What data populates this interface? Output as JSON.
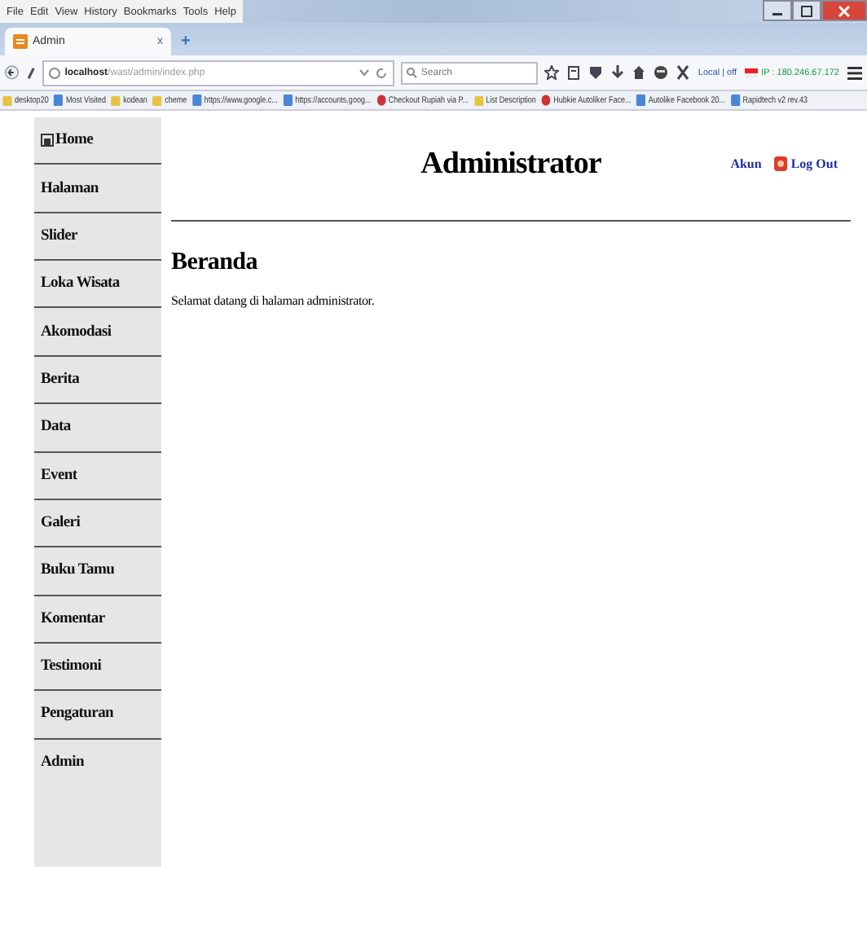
{
  "menu_bar": [
    "File",
    "Edit",
    "View",
    "History",
    "Bookmarks",
    "Tools",
    "Help"
  ],
  "tabs": [
    {
      "label": "Admin",
      "close": "x",
      "selected": true
    }
  ],
  "new_tab": "+",
  "address_bar": {
    "host": "localhost",
    "path": "/wast/admin/index.php"
  },
  "search": {
    "placeholder": "Search"
  },
  "ip_info": {
    "status": "Local | off",
    "ip": "IP : 180.246.67.172"
  },
  "bookmarks": [
    {
      "label": "desktop20",
      "kind": "folder"
    },
    {
      "label": "Most Visited",
      "kind": "page"
    },
    {
      "label": "kodean",
      "kind": "folder"
    },
    {
      "label": "cheme",
      "kind": "folder"
    },
    {
      "label": "https://www.google.c...",
      "kind": "page"
    },
    {
      "label": "https://accounts.goog...",
      "kind": "page"
    },
    {
      "label": "Checkout Rupiah via P...",
      "kind": "site"
    },
    {
      "label": "List Description",
      "kind": "folder"
    },
    {
      "label": "Hubkie Autoliker Face...",
      "kind": "site"
    },
    {
      "label": "Autolike Facebook 20...",
      "kind": "page"
    },
    {
      "label": "Rapidtech v2 rev.43",
      "kind": "page"
    }
  ],
  "sidebar": {
    "items": [
      {
        "label": "Home",
        "icon": true
      },
      {
        "label": "Halaman",
        "icon": false
      },
      {
        "label": "Slider",
        "icon": false
      },
      {
        "label": "Loka Wisata",
        "icon": false
      },
      {
        "label": "Akomodasi",
        "icon": false
      },
      {
        "label": "Berita",
        "icon": false
      },
      {
        "label": "Data",
        "icon": false
      },
      {
        "label": "Event",
        "icon": false
      },
      {
        "label": "Galeri",
        "icon": false
      },
      {
        "label": "Buku Tamu",
        "icon": false
      },
      {
        "label": "Komentar",
        "icon": false
      },
      {
        "label": "Testimoni",
        "icon": false
      },
      {
        "label": "Pengaturan",
        "icon": false
      },
      {
        "label": "Admin",
        "icon": false
      }
    ]
  },
  "header": {
    "title": "Administrator",
    "links": [
      {
        "label": "Akun",
        "icon": false
      },
      {
        "label": "Log Out",
        "icon": true
      }
    ]
  },
  "content": {
    "heading": "Beranda",
    "text": "Selamat datang di halaman administrator."
  }
}
